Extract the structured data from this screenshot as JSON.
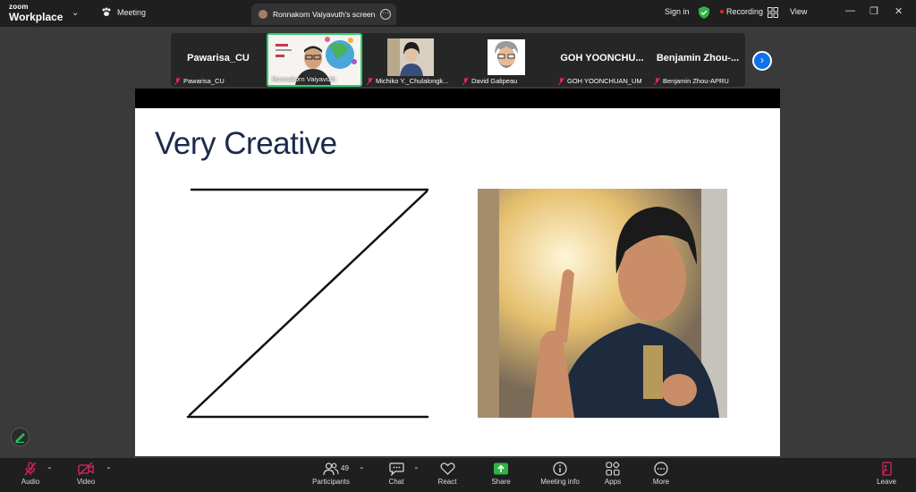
{
  "app": {
    "brand_small": "zoom",
    "brand_large": "Workplace",
    "meeting_label": "Meeting"
  },
  "share_tab": {
    "title": "Ronnakorn Vaiyavuth's screen"
  },
  "header_right": {
    "signin": "Sign in",
    "recording": "Recording",
    "view": "View",
    "recording_color": "#e02828",
    "shield_color": "#2fb344"
  },
  "participants_strip": [
    {
      "big_name": "Pawarisa_CU",
      "label": "Pawarisa_CU",
      "muted": true
    },
    {
      "big_name": "",
      "label": "Ronnakorn Vaiyavuth",
      "muted": false,
      "active_speaker": true
    },
    {
      "big_name": "",
      "label": "Michiko Y._Chulalongk...",
      "muted": true
    },
    {
      "big_name": "",
      "label": "David Galipeau",
      "muted": true
    },
    {
      "big_name": "GOH  YOONCHU...",
      "label": "GOH YOONCHUAN_UM",
      "muted": true
    },
    {
      "big_name": "Benjamin  Zhou-...",
      "label": "Benjamin Zhou-APRU",
      "muted": true
    }
  ],
  "slide": {
    "title": "Very Creative"
  },
  "toolbar": {
    "audio": "Audio",
    "video": "Video",
    "participants": "Participants",
    "participants_count": "49",
    "chat": "Chat",
    "react": "React",
    "share": "Share",
    "meeting_info": "Meeting info",
    "apps": "Apps",
    "more": "More",
    "leave": "Leave",
    "share_color": "#2fb344",
    "muted_color": "#e0245e"
  }
}
